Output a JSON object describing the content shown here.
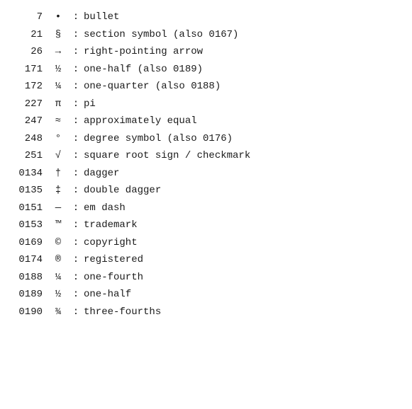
{
  "rows": [
    {
      "code": "7",
      "symbol": "•",
      "description": "bullet"
    },
    {
      "code": "21",
      "symbol": "§",
      "description": "section symbol (also 0167)"
    },
    {
      "code": "26",
      "symbol": "→",
      "description": "right-pointing arrow"
    },
    {
      "code": "171",
      "symbol": "½",
      "description": "one-half (also 0189)"
    },
    {
      "code": "172",
      "symbol": "¼",
      "description": "one-quarter (also 0188)"
    },
    {
      "code": "227",
      "symbol": "π",
      "description": "pi"
    },
    {
      "code": "247",
      "symbol": "≈",
      "description": "approximately equal"
    },
    {
      "code": "248",
      "symbol": "°",
      "description": "degree symbol (also 0176)"
    },
    {
      "code": "251",
      "symbol": "√",
      "description": "square root sign / checkmark"
    },
    {
      "code": "0134",
      "symbol": "†",
      "description": "dagger"
    },
    {
      "code": "0135",
      "symbol": "‡",
      "description": "double dagger"
    },
    {
      "code": "0151",
      "symbol": "—",
      "description": "em dash"
    },
    {
      "code": "0153",
      "symbol": "™",
      "description": "trademark"
    },
    {
      "code": "0169",
      "symbol": "©",
      "description": "copyright"
    },
    {
      "code": "0174",
      "symbol": "®",
      "description": "registered"
    },
    {
      "code": "0188",
      "symbol": "¼",
      "description": "one-fourth"
    },
    {
      "code": "0189",
      "symbol": "½",
      "description": "one-half"
    },
    {
      "code": "0190",
      "symbol": "¾",
      "description": "three-fourths"
    }
  ],
  "separator": ":"
}
